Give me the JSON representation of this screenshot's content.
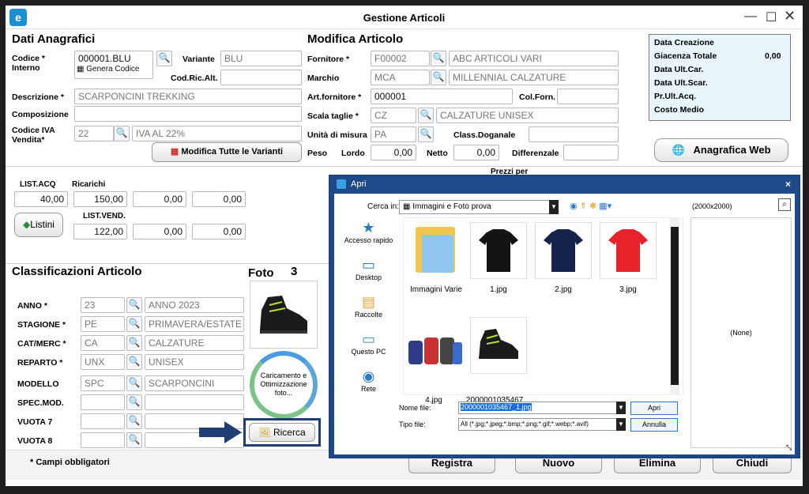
{
  "window": {
    "title": "Gestione Articoli"
  },
  "anag": {
    "title": "Dati Anagrafici",
    "codice_label": "Codice * Interno",
    "codice_value": "000001.BLU",
    "genera_label": "Genera Codice",
    "variante_label": "Variante",
    "variante_value": "BLU",
    "codric_label": "Cod.Ric.Alt.",
    "descr_label": "Descrizione *",
    "descr_value": "SCARPONCINI TREKKING",
    "comp_label": "Composizione",
    "iva_label": "Codice IVA Vendita*",
    "iva_code": "22",
    "iva_desc": "IVA AL 22%",
    "modifica_varianti": "Modifica Tutte le Varianti"
  },
  "modifica": {
    "title": "Modifica Articolo",
    "fornitore_label": "Fornitore *",
    "fornitore_code": "F00002",
    "fornitore_desc": "ABC ARTICOLI VARI",
    "marchio_label": "Marchio",
    "marchio_code": "MCA",
    "marchio_desc": "MILLENNIAL CALZATURE",
    "artforn_label": "Art.fornitore *",
    "artforn_value": "000001",
    "colforn_label": "Col.Forn.",
    "scala_label": "Scala taglie *",
    "scala_code": "CZ",
    "scala_desc": "CALZATURE UNISEX",
    "um_label": "Unità di misura",
    "um_value": "PA",
    "class_label": "Class.Doganale",
    "peso_label": "Peso",
    "lordo_label": "Lordo",
    "lordo_value": "0,00",
    "netto_label": "Netto",
    "netto_value": "0,00",
    "diff_label": "Differenzale"
  },
  "info": {
    "creazione": "Data Creazione",
    "giacenza": "Giacenza Totale",
    "giacenza_value": "0,00",
    "ultcar": "Data Ult.Car.",
    "ultscar": "Data Ult.Scar.",
    "ultacq": "Pr.Ult.Acq.",
    "costo": "Costo Medio"
  },
  "web_button": "Anagrafica Web",
  "prezzi": {
    "prezzi_per": "Prezzi per",
    "listacq_label": "LIST.ACQ",
    "ricarichi_label": "Ricarichi",
    "listacq_value": "40,00",
    "ric1": "150,00",
    "ric2": "0,00",
    "ric3": "0,00",
    "listini_button": "Listini",
    "listvend_label": "LIST.VEND.",
    "vend1": "122,00",
    "vend2": "0,00",
    "vend3": "0,00"
  },
  "classif": {
    "title": "Classificazioni Articolo",
    "rows": [
      {
        "label": "ANNO *",
        "code": "23",
        "desc": "ANNO 2023"
      },
      {
        "label": "STAGIONE *",
        "code": "PE",
        "desc": "PRIMAVERA/ESTATE"
      },
      {
        "label": "CAT/MERC *",
        "code": "CA",
        "desc": "CALZATURE"
      },
      {
        "label": "REPARTO *",
        "code": "UNX",
        "desc": "UNISEX"
      },
      {
        "label": "MODELLO",
        "code": "SPC",
        "desc": "SCARPONCINI"
      },
      {
        "label": "SPEC.MOD.",
        "code": "",
        "desc": ""
      },
      {
        "label": "VUOTA 7",
        "code": "",
        "desc": ""
      },
      {
        "label": "VUOTA 8",
        "code": "",
        "desc": ""
      }
    ]
  },
  "foto": {
    "label": "Foto",
    "count": "3",
    "loading": "Caricamento e Ottimizzazione foto...",
    "ricerca": "Ricerca"
  },
  "footer": {
    "note": "* Campi obbligatori",
    "registra": "Registra",
    "nuovo": "Nuovo",
    "elimina": "Elimina",
    "chiudi": "Chiudi"
  },
  "dialog": {
    "title": "Apri",
    "cerca_label": "Cerca in:",
    "cerca_value": "Immagini e Foto prova",
    "places": [
      "Accesso rapido",
      "Desktop",
      "Raccolte",
      "Questo PC",
      "Rete"
    ],
    "files": [
      "Immagini Varie",
      "1.jpg",
      "2.jpg",
      "3.jpg",
      "4.jpg",
      "2000001035467_..."
    ],
    "preview_size": "(2000x2000)",
    "preview_none": "(None)",
    "nome_label": "Nome file:",
    "nome_value": "2000001035467_1.jpg",
    "tipo_label": "Tipo file:",
    "tipo_value": "All (*.jpg;*.jpeg;*.bmp;*.png;*.gif;*.webp;*.avif)",
    "apri_button": "Apri",
    "annulla_button": "Annulla"
  },
  "colors": {
    "accent": "#1f4a8a",
    "highlight": "#1f6fd8",
    "info_bg": "#e8f5fd"
  }
}
